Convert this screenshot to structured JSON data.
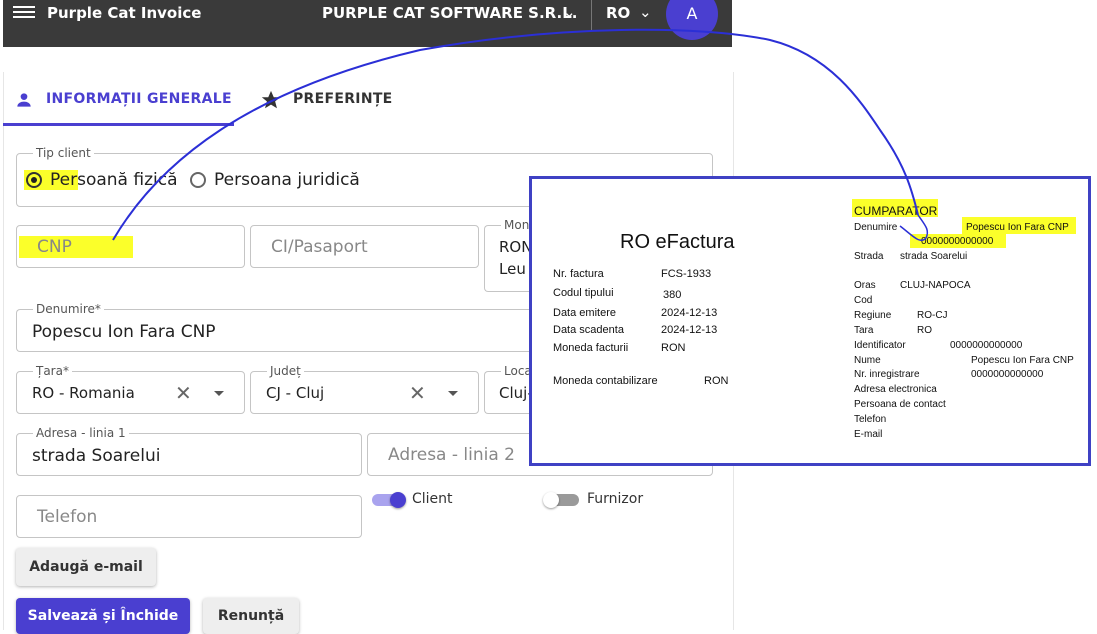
{
  "appbar": {
    "title": "Purple Cat Invoice",
    "company": "PURPLE CAT SOFTWARE S.R.L.",
    "language": "RO",
    "avatar_letter": "A"
  },
  "tabs": [
    {
      "label": "INFORMAȚII GENERALE"
    },
    {
      "label": "PREFERINȚE"
    }
  ],
  "form": {
    "tip_client": {
      "label": "Tip client",
      "option_fizica": "Persoană fizică",
      "option_juridica": "Persoana juridică"
    },
    "cnp_placeholder": "CNP",
    "ci_placeholder": "CI/Pasaport",
    "moneda": {
      "label": "Mon",
      "value_line1": "RON",
      "value_line2": "Leu"
    },
    "denumire": {
      "label": "Denumire*",
      "value": "Popescu Ion Fara CNP"
    },
    "tara": {
      "label": "Țara*",
      "value": "RO - Romania"
    },
    "judet": {
      "label": "Județ",
      "value": "CJ - Cluj"
    },
    "localitate": {
      "label": "Loca",
      "value": "Cluj-"
    },
    "adresa1": {
      "label": "Adresa - linia 1",
      "value": "strada Soarelui"
    },
    "adresa2_placeholder": "Adresa - linia 2",
    "telefon_placeholder": "Telefon",
    "switch_client": "Client",
    "switch_furnizor": "Furnizor",
    "add_email": "Adaugă e-mail",
    "save": "Salvează și Închide",
    "cancel": "Renunță"
  },
  "invoice": {
    "title": "RO eFactura",
    "left_rows": [
      {
        "label": "Nr. factura",
        "value": "FCS-1933"
      },
      {
        "label": "Codul tipului",
        "value": "380"
      },
      {
        "label": "Data emitere",
        "value": "2024-12-13"
      },
      {
        "label": "Data scadenta",
        "value": "2024-12-13"
      },
      {
        "label": "Moneda facturii",
        "value": "RON"
      }
    ],
    "moneda_contabilizare": {
      "label": "Moneda contabilizare",
      "value": "RON"
    },
    "buyer": {
      "heading": "CUMPARATOR",
      "denumire_label": "Denumire",
      "denumire_value": "Popescu Ion Fara CNP",
      "code": "0000000000000",
      "strada_label": "Strada",
      "strada_value": "strada Soarelui",
      "oras_label": "Oras",
      "oras_value": "CLUJ-NAPOCA",
      "cod_label": "Cod",
      "regiune_label": "Regiune",
      "regiune_value": "RO-CJ",
      "tara_label": "Tara",
      "tara_value": "RO",
      "identificator_label": "Identificator",
      "identificator_value": "0000000000000",
      "nume_label": "Nume",
      "nume_value": "Popescu Ion Fara CNP",
      "nr_inreg_label": "Nr. inregistrare",
      "nr_inreg_value": "0000000000000",
      "adresa_label": "Adresa electronica",
      "persoana_label": "Persoana de contact",
      "telefon_label": "Telefon",
      "email_label": "E-mail"
    }
  },
  "colors": {
    "accent": "#4a3fd0",
    "appbar": "#3a3a3a",
    "highlight": "#fbff2a",
    "annotation": "#2b2fd6",
    "frame": "#3f41c4"
  }
}
